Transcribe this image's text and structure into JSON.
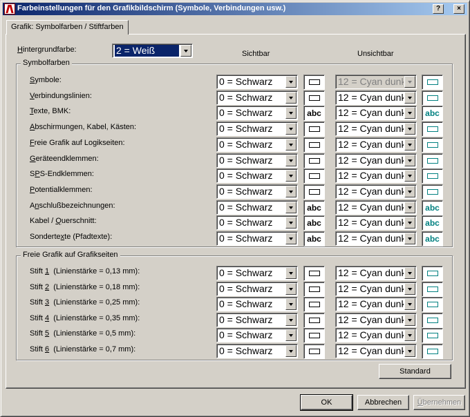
{
  "window": {
    "title": "Farbeinstellungen für den Grafikbildschirm (Symbole, Verbindungen usw.)",
    "help_glyph": "?",
    "close_glyph": "×"
  },
  "tab": {
    "label": "Grafik: Symbolfarben / Stiftfarben"
  },
  "background": {
    "label": "Hintergrundfarbe:",
    "label_accel": "H",
    "label_rest": "intergrundfarbe:",
    "value": "2 = Weiß"
  },
  "columns": {
    "visible": "Sichtbar",
    "invisible": "Unsichtbar"
  },
  "symbol_group": {
    "title": "Symbolfarben",
    "rows": [
      {
        "accel": "S",
        "rest": "ymbole:",
        "visible": "0 = Schwarz",
        "invisible": "12 = Cyan dunkel",
        "invisible_disabled": true,
        "swatch": "line"
      },
      {
        "accel": "V",
        "rest": "erbindungslinien:",
        "visible": "0 = Schwarz",
        "invisible": "12 = Cyan dunkel",
        "swatch": "line"
      },
      {
        "accel": "T",
        "rest": "exte, BMK:",
        "visible": "0 = Schwarz",
        "invisible": "12 = Cyan dunkel",
        "swatch": "abc"
      },
      {
        "accel": "A",
        "rest": "bschirmungen, Kabel, Kästen:",
        "visible": "0 = Schwarz",
        "invisible": "12 = Cyan dunkel",
        "swatch": "line"
      },
      {
        "accel": "F",
        "rest": "reie Grafik auf Logikseiten:",
        "visible": "0 = Schwarz",
        "invisible": "12 = Cyan dunkel",
        "swatch": "line"
      },
      {
        "accel": "G",
        "rest": "eräteendklemmen:",
        "visible": "0 = Schwarz",
        "invisible": "12 = Cyan dunkel",
        "swatch": "line"
      },
      {
        "pre": "S",
        "accel": "P",
        "rest": "S-Endklemmen:",
        "visible": "0 = Schwarz",
        "invisible": "12 = Cyan dunkel",
        "swatch": "line"
      },
      {
        "accel": "P",
        "rest": "otentialklemmen:",
        "visible": "0 = Schwarz",
        "invisible": "12 = Cyan dunkel",
        "swatch": "line"
      },
      {
        "pre": "A",
        "accel": "n",
        "rest": "schlußbezeichnungen:",
        "visible": "0 = Schwarz",
        "invisible": "12 = Cyan dunkel",
        "swatch": "abc"
      },
      {
        "pre": "Kabel / ",
        "accel": "Q",
        "rest": "uerschnitt:",
        "visible": "0 = Schwarz",
        "invisible": "12 = Cyan dunkel",
        "swatch": "abc"
      },
      {
        "pre": "Sonderte",
        "accel": "x",
        "rest": "te (Pfadtexte):",
        "visible": "0 = Schwarz",
        "invisible": "12 = Cyan dunkel",
        "swatch": "abc"
      }
    ],
    "abc_text": "abc"
  },
  "pen_group": {
    "title": "Freie Grafik auf Grafikseiten",
    "rows": [
      {
        "pre": "Stift ",
        "accel": "1",
        "rest": "  (Linienstärke = 0,13 mm):",
        "visible": "0 = Schwarz",
        "invisible": "12 = Cyan dunkel"
      },
      {
        "pre": "Stift ",
        "accel": "2",
        "rest": "  (Linienstärke = 0,18 mm):",
        "visible": "0 = Schwarz",
        "invisible": "12 = Cyan dunkel"
      },
      {
        "pre": "Stift ",
        "accel": "3",
        "rest": "  (Linienstärke = 0,25 mm):",
        "visible": "0 = Schwarz",
        "invisible": "12 = Cyan dunkel"
      },
      {
        "pre": "Stift ",
        "accel": "4",
        "rest": "  (Linienstärke = 0,35 mm):",
        "visible": "0 = Schwarz",
        "invisible": "12 = Cyan dunkel"
      },
      {
        "pre": "Stift ",
        "accel": "5",
        "rest": "  (Linienstärke = 0,5 mm):",
        "visible": "0 = Schwarz",
        "invisible": "12 = Cyan dunkel"
      },
      {
        "pre": "Stift ",
        "accel": "6",
        "rest": "  (Linienstärke = 0,7 mm):",
        "visible": "0 = Schwarz",
        "invisible": "12 = Cyan dunkel"
      }
    ]
  },
  "buttons": {
    "standard": "Standard",
    "ok": "OK",
    "cancel": "Abbrechen",
    "apply_accel": "Ü",
    "apply_rest": "bernehmen"
  },
  "colors": {
    "title_gradient_start": "#0a246a",
    "title_gradient_end": "#a6caf0",
    "dialog_face": "#d4d0c8",
    "cyan_dark": "#008080",
    "selection": "#0a246a"
  }
}
